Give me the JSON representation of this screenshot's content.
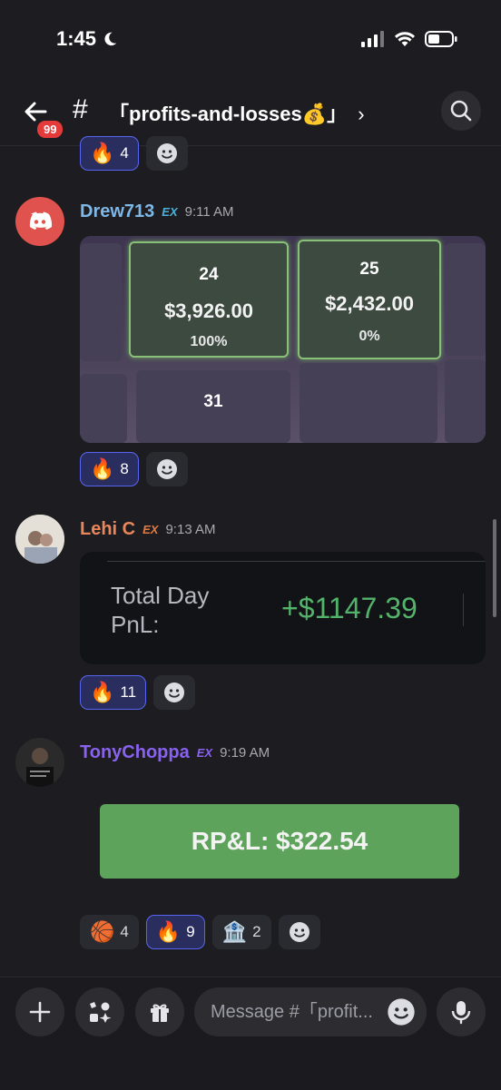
{
  "status": {
    "time": "1:45",
    "moon_icon": "moon-icon",
    "signal_icon": "cellular-signal-icon",
    "wifi_icon": "wifi-icon",
    "battery_icon": "battery-icon"
  },
  "header": {
    "back_badge": "99",
    "hash": "#",
    "channel_name": "「profits-and-losses💰」",
    "chevron": "›"
  },
  "top_reactions": [
    {
      "emoji": "🔥",
      "count": "4",
      "active": true
    }
  ],
  "messages": [
    {
      "user": "Drew713",
      "tag": "EX",
      "time": "9:11 AM",
      "user_color": "#7fb8e6",
      "tag_color": "#4db0d8",
      "image": {
        "cells": [
          {
            "day": "24",
            "amount": "$3,926.00",
            "pct": "100%"
          },
          {
            "day": "25",
            "amount": "$2,432.00",
            "pct": "0%"
          },
          {
            "day": "31"
          }
        ]
      },
      "reactions": [
        {
          "emoji": "🔥",
          "count": "8",
          "active": true
        }
      ]
    },
    {
      "user": "Lehi C",
      "tag": "EX",
      "time": "9:13 AM",
      "user_color": "#e9865a",
      "tag_color": "#e07a40",
      "card": {
        "label": "Total Day PnL:",
        "value": "+$1147.39"
      },
      "reactions": [
        {
          "emoji": "🔥",
          "count": "11",
          "active": true
        }
      ]
    },
    {
      "user": "TonyChoppa",
      "tag": "EX",
      "time": "9:19 AM",
      "user_color": "#8a62f0",
      "tag_color": "#8a62f0",
      "banner": "RP&L: $322.54",
      "reactions": [
        {
          "emoji": "🏀",
          "count": "4",
          "active": false
        },
        {
          "emoji": "🔥",
          "count": "9",
          "active": true
        },
        {
          "emoji": "🏦",
          "count": "2",
          "active": false
        }
      ]
    }
  ],
  "composer": {
    "placeholder": "Message #「profit..."
  },
  "colors": {
    "background": "#1d1d21",
    "accent": "#5865f2",
    "pnl_green": "#53b36a",
    "banner_green": "#5da35b",
    "badge_red": "#e53a3a"
  }
}
